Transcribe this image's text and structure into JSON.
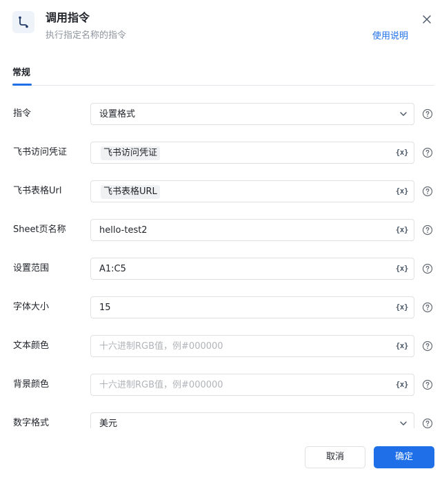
{
  "header": {
    "title": "调用指令",
    "subtitle": "执行指定名称的指令",
    "help_link": "使用说明"
  },
  "tabs": [
    {
      "label": "常规",
      "active": true
    }
  ],
  "form": {
    "command": {
      "label": "指令",
      "value": "设置格式"
    },
    "credential": {
      "label": "飞书访问凭证",
      "value": "飞书访问凭证"
    },
    "sheet_url": {
      "label": "飞书表格Url",
      "value": "飞书表格URL"
    },
    "sheet_name": {
      "label": "Sheet页名称",
      "value": "hello-test2"
    },
    "range": {
      "label": "设置范围",
      "value": "A1:C5"
    },
    "font_size": {
      "label": "字体大小",
      "value": "15"
    },
    "text_color": {
      "label": "文本颜色",
      "value": "",
      "placeholder": "十六进制RGB值，例#000000"
    },
    "bg_color": {
      "label": "背景颜色",
      "value": "",
      "placeholder": "十六进制RGB值，例#000000"
    },
    "number_format": {
      "label": "数字格式",
      "value": "美元"
    }
  },
  "var_icon_text": "{x}",
  "icons": {
    "app": "flow-icon",
    "close": "close-icon",
    "dropdown": "chevron-down-icon",
    "help": "question-circle-icon",
    "variable": "variable-icon"
  },
  "footer": {
    "cancel_label": "取消",
    "ok_label": "确定"
  },
  "colors": {
    "accent": "#1f6fe8",
    "border": "#dee0e3",
    "placeholder": "#b0b3b8",
    "muted": "#8f959e"
  }
}
